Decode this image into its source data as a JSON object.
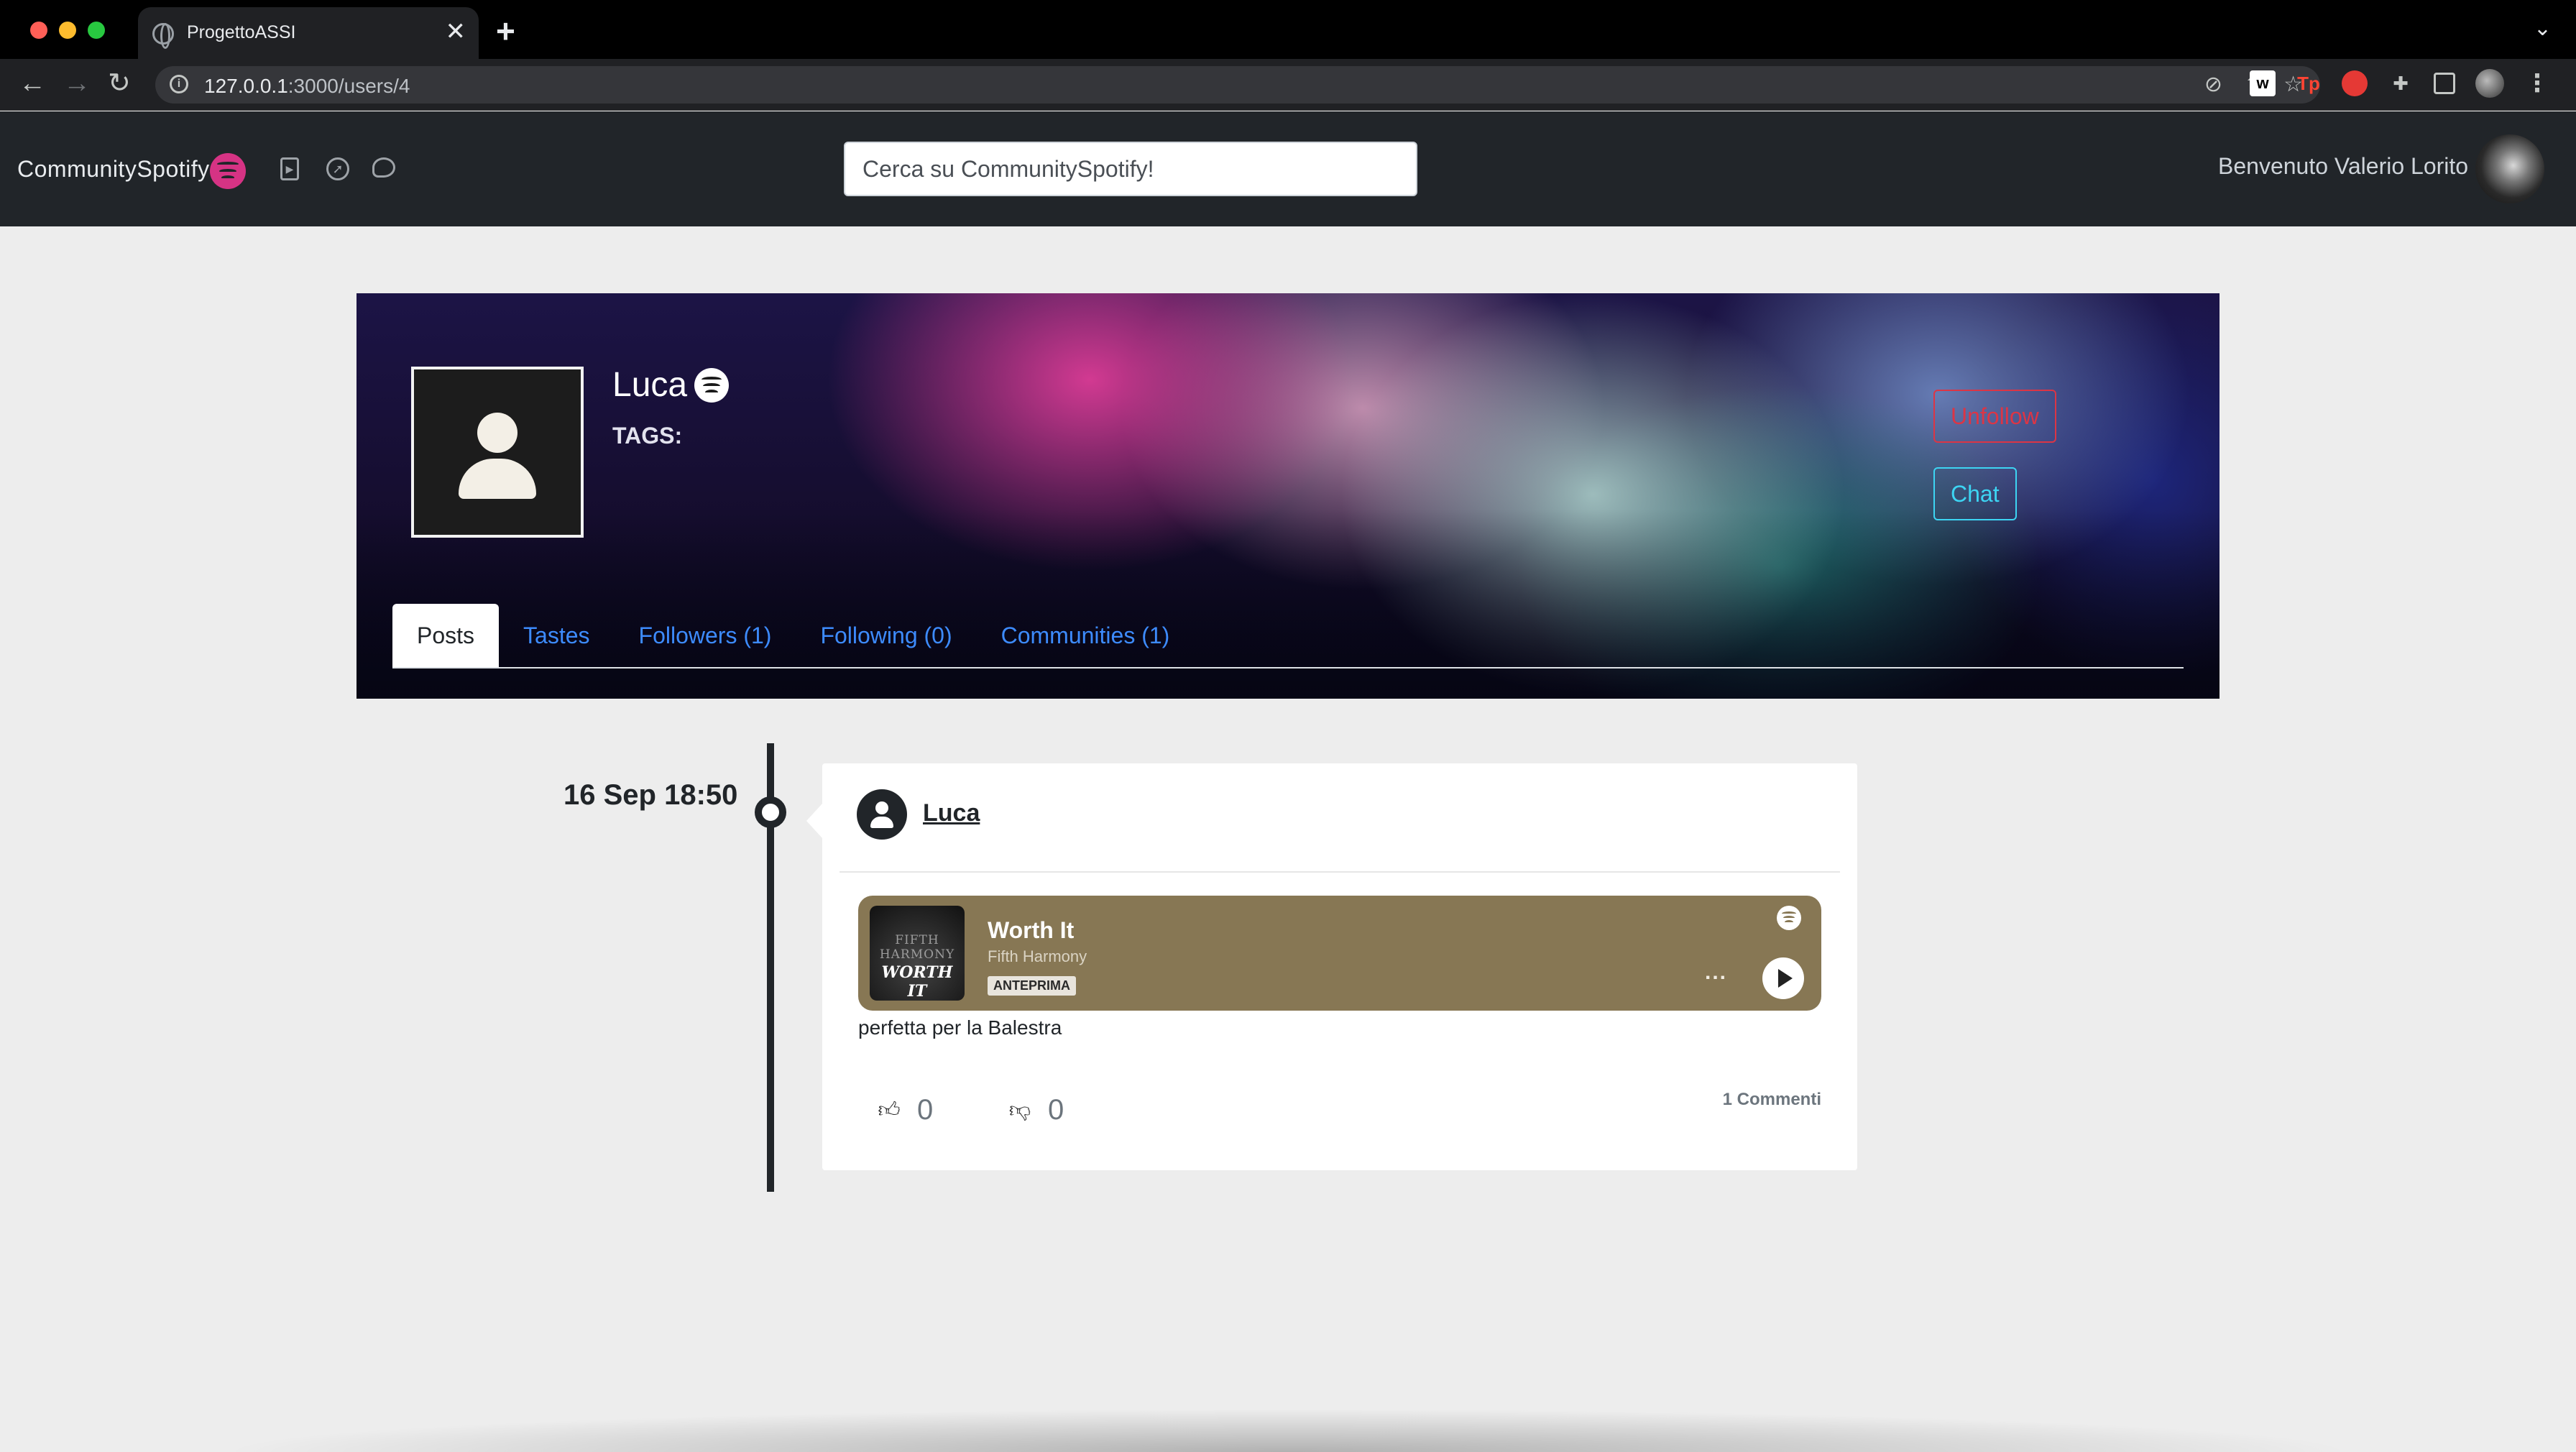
{
  "browser": {
    "tab_title": "ProgettoASSI",
    "tab_close": "✕",
    "new_tab": "+",
    "url_host": "127.0.0.1",
    "url_rest": ":3000/users/4",
    "extensions": [
      "w",
      "Tp"
    ]
  },
  "navbar": {
    "brand": "CommunitySpotify",
    "brand_color": "#d63384",
    "icons": [
      "music-file-icon",
      "compass-icon",
      "chat-bubble-icon"
    ],
    "search_placeholder": "Cerca su CommunitySpotify!",
    "welcome": "Benvenuto Valerio Lorito"
  },
  "profile": {
    "name": "Luca",
    "tags_label": "TAGS:",
    "unfollow_label": "Unfollow",
    "chat_label": "Chat",
    "tabs": [
      {
        "label": "Posts",
        "active": true
      },
      {
        "label": "Tastes"
      },
      {
        "label": "Followers (1)"
      },
      {
        "label": "Following (0)"
      },
      {
        "label": "Communities (1)"
      }
    ]
  },
  "post": {
    "date": "16 Sep 18:50",
    "author": "Luca",
    "embed": {
      "cover_line1": "FIFTH HARMONY",
      "cover_line2": "WORTH IT",
      "title": "Worth It",
      "artist": "Fifth Harmony",
      "badge": "ANTEPRIMA",
      "more": "...",
      "background": "#877754"
    },
    "text": "perfetta per la Balestra",
    "likes": "0",
    "dislikes": "0",
    "comments": "1 Commenti"
  }
}
